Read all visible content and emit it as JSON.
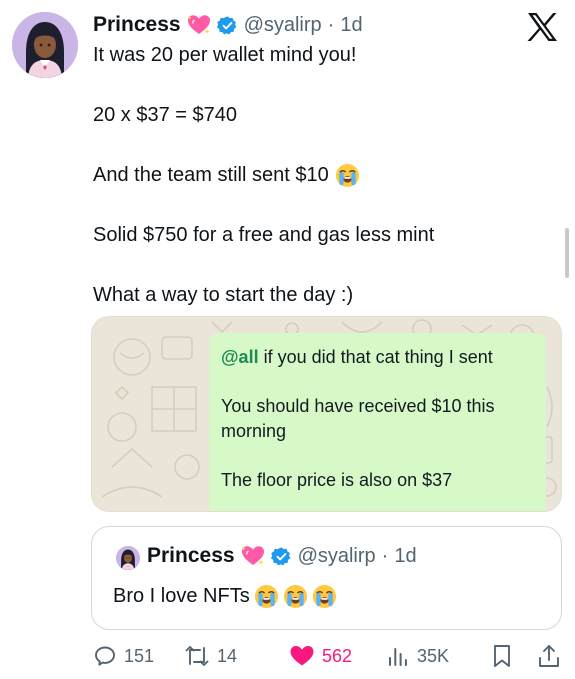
{
  "tweet": {
    "author_name": "Princess",
    "handle": "@syalirp",
    "separator": "·",
    "time": "1d",
    "lines": [
      "It was 20 per wallet mind you!",
      "20 x $37 = $740",
      "And the team still sent $10",
      "Solid $750 for a free and gas less mint",
      "What a way to start the day :)"
    ]
  },
  "media": {
    "chat_mention": "@all",
    "chat_line1_rest": " if you did that cat thing I sent",
    "chat_line2": "You should have received $10 this",
    "chat_line3": "morning",
    "chat_line4": "The floor price is also on $37"
  },
  "quote": {
    "author_name": "Princess",
    "handle": "@syalirp",
    "separator": "·",
    "time": "1d",
    "text": "Bro I love NFTs"
  },
  "actions": {
    "replies": "151",
    "reposts": "14",
    "likes": "562",
    "views": "35K"
  },
  "icons": [
    "avatar",
    "sparkling-heart-emoji",
    "verified-badge-icon",
    "x-logo-icon",
    "crying-face-emoji",
    "reply-icon",
    "repost-icon",
    "like-heart-icon",
    "views-icon",
    "bookmark-icon",
    "share-icon"
  ],
  "colors": {
    "text": "#0f1419",
    "secondary": "#536471",
    "verified": "#1d9bf0",
    "like": "#f91880",
    "chat_bubble": "#d7f9c8",
    "mention": "#1f8a52"
  }
}
